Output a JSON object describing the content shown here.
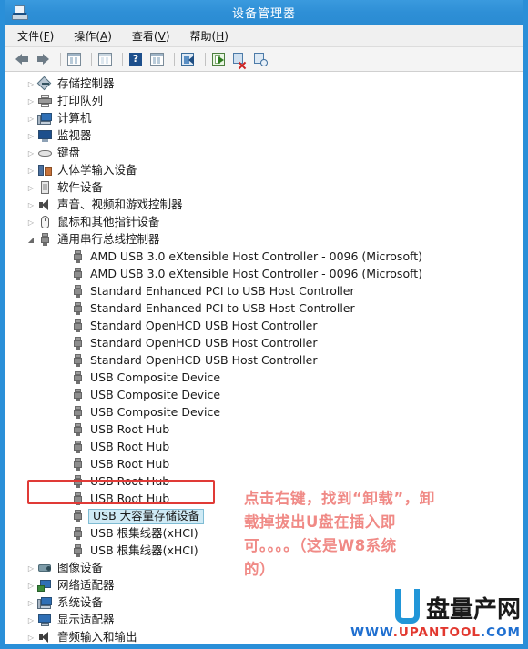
{
  "window": {
    "title": "设备管理器",
    "icon": "device-manager-icon"
  },
  "menubar": {
    "items": [
      {
        "label": "文件",
        "accel": "F"
      },
      {
        "label": "操作",
        "accel": "A"
      },
      {
        "label": "查看",
        "accel": "V"
      },
      {
        "label": "帮助",
        "accel": "H"
      }
    ]
  },
  "toolbar": {
    "buttons": [
      {
        "name": "back-icon"
      },
      {
        "name": "forward-icon"
      },
      {
        "name": "properties-icon"
      },
      {
        "name": "view-icon"
      },
      {
        "name": "help-icon"
      },
      {
        "name": "show-hidden-devices-icon"
      },
      {
        "name": "scan-hardware-changes-icon"
      },
      {
        "name": "update-driver-icon"
      },
      {
        "name": "uninstall-device-icon"
      },
      {
        "name": "refresh-icon"
      }
    ]
  },
  "tree": {
    "nodes": [
      {
        "label": "存储控制器",
        "level": 1,
        "twisty": "collapsed",
        "icon": "storage-controller-icon"
      },
      {
        "label": "打印队列",
        "level": 1,
        "twisty": "collapsed",
        "icon": "print-queue-icon"
      },
      {
        "label": "计算机",
        "level": 1,
        "twisty": "collapsed",
        "icon": "computer-icon"
      },
      {
        "label": "监视器",
        "level": 1,
        "twisty": "collapsed",
        "icon": "monitor-icon"
      },
      {
        "label": "键盘",
        "level": 1,
        "twisty": "collapsed",
        "icon": "keyboard-icon"
      },
      {
        "label": "人体学输入设备",
        "level": 1,
        "twisty": "collapsed",
        "icon": "hid-icon"
      },
      {
        "label": "软件设备",
        "level": 1,
        "twisty": "collapsed",
        "icon": "software-device-icon"
      },
      {
        "label": "声音、视频和游戏控制器",
        "level": 1,
        "twisty": "collapsed",
        "icon": "sound-video-game-icon"
      },
      {
        "label": "鼠标和其他指针设备",
        "level": 1,
        "twisty": "collapsed",
        "icon": "mouse-icon"
      },
      {
        "label": "通用串行总线控制器",
        "level": 1,
        "twisty": "expanded",
        "icon": "usb-icon"
      },
      {
        "label": "AMD USB 3.0 eXtensible Host Controller - 0096 (Microsoft)",
        "level": 2,
        "twisty": "none",
        "icon": "usb-icon"
      },
      {
        "label": "AMD USB 3.0 eXtensible Host Controller - 0096 (Microsoft)",
        "level": 2,
        "twisty": "none",
        "icon": "usb-icon"
      },
      {
        "label": "Standard Enhanced PCI to USB Host Controller",
        "level": 2,
        "twisty": "none",
        "icon": "usb-icon"
      },
      {
        "label": "Standard Enhanced PCI to USB Host Controller",
        "level": 2,
        "twisty": "none",
        "icon": "usb-icon"
      },
      {
        "label": "Standard OpenHCD USB Host Controller",
        "level": 2,
        "twisty": "none",
        "icon": "usb-icon"
      },
      {
        "label": "Standard OpenHCD USB Host Controller",
        "level": 2,
        "twisty": "none",
        "icon": "usb-icon"
      },
      {
        "label": "Standard OpenHCD USB Host Controller",
        "level": 2,
        "twisty": "none",
        "icon": "usb-icon"
      },
      {
        "label": "USB Composite Device",
        "level": 2,
        "twisty": "none",
        "icon": "usb-icon"
      },
      {
        "label": "USB Composite Device",
        "level": 2,
        "twisty": "none",
        "icon": "usb-icon"
      },
      {
        "label": "USB Composite Device",
        "level": 2,
        "twisty": "none",
        "icon": "usb-icon"
      },
      {
        "label": "USB Root Hub",
        "level": 2,
        "twisty": "none",
        "icon": "usb-icon"
      },
      {
        "label": "USB Root Hub",
        "level": 2,
        "twisty": "none",
        "icon": "usb-icon"
      },
      {
        "label": "USB Root Hub",
        "level": 2,
        "twisty": "none",
        "icon": "usb-icon"
      },
      {
        "label": "USB Root Hub",
        "level": 2,
        "twisty": "none",
        "icon": "usb-icon"
      },
      {
        "label": "USB Root Hub",
        "level": 2,
        "twisty": "none",
        "icon": "usb-icon"
      },
      {
        "label": "USB 大容量存储设备",
        "level": 2,
        "twisty": "none",
        "icon": "usb-icon",
        "selected": true
      },
      {
        "label": "USB 根集线器(xHCI)",
        "level": 2,
        "twisty": "none",
        "icon": "usb-icon"
      },
      {
        "label": "USB 根集线器(xHCI)",
        "level": 2,
        "twisty": "none",
        "icon": "usb-icon"
      },
      {
        "label": "图像设备",
        "level": 1,
        "twisty": "collapsed",
        "icon": "imaging-device-icon"
      },
      {
        "label": "网络适配器",
        "level": 1,
        "twisty": "collapsed",
        "icon": "network-adapter-icon"
      },
      {
        "label": "系统设备",
        "level": 1,
        "twisty": "collapsed",
        "icon": "system-device-icon"
      },
      {
        "label": "显示适配器",
        "level": 1,
        "twisty": "collapsed",
        "icon": "display-adapter-icon"
      },
      {
        "label": "音频输入和输出",
        "level": 1,
        "twisty": "collapsed",
        "icon": "audio-io-icon"
      }
    ]
  },
  "annotation": {
    "lines": [
      "点击右键，找到“卸载”，卸",
      "载掉拔出U盘在插入即",
      "可。。。。（这是W8系统",
      "的）"
    ],
    "color": "#f08a86"
  },
  "watermark": {
    "brand_cn": "盘量产网",
    "logo_letter": "U",
    "url_parts": [
      {
        "text": "WWW",
        "color": "blue"
      },
      {
        "text": ".",
        "color": "red"
      },
      {
        "text": "UPANTOOL",
        "color": "red"
      },
      {
        "text": ".",
        "color": "blue"
      },
      {
        "text": "COM",
        "color": "blue"
      }
    ]
  },
  "colors": {
    "titlebar": "#2e8fd6",
    "selection": "#cfeaf5",
    "redbox": "#e03a36",
    "annotation": "#f08a86",
    "logo_blue": "#2196d8"
  }
}
